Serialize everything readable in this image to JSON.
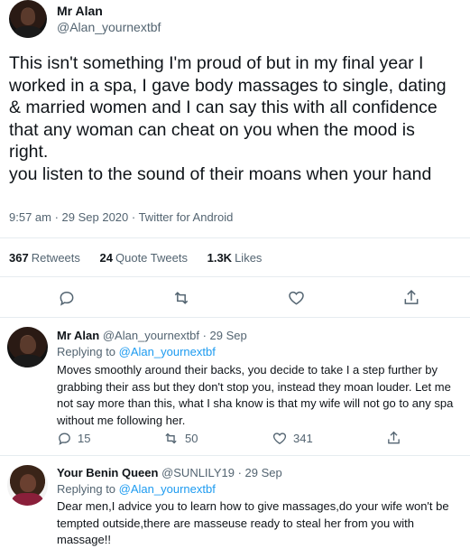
{
  "main_tweet": {
    "author_name": "Mr Alan",
    "author_handle": "@Alan_yournextbf",
    "text_lines": [
      "This isn't something I'm proud of but in my final year I",
      "worked in a spa, I gave body massages to single, dating",
      "& married women and I can say this with all confidence",
      "that any woman can cheat on you when the mood is",
      "right.",
      "you listen to the sound of their moans when your hand"
    ],
    "timestamp": "9:57 am · 29 Sep 2020 · Twitter for Android",
    "retweets_count": "367",
    "retweets_label": "Retweets",
    "quotes_count": "24",
    "quotes_label": "Quote Tweets",
    "likes_count": "1.3K",
    "likes_label": "Likes"
  },
  "replies": [
    {
      "author_name": "Mr Alan",
      "author_handle": "@Alan_yournextbf",
      "date": "· 29 Sep",
      "replying_to_label": "Replying to",
      "replying_to_handle": "@Alan_yournextbf",
      "text_lines": [
        "Moves smoothly around their backs, you decide to take I a step further by",
        "grabbing their ass but they don't stop you, instead they moan louder. Let me",
        "not say more than this, what I sha know is that my wife will not go to any spa",
        "without me following her."
      ],
      "reply_count": "15",
      "retweet_count": "50",
      "like_count": "341"
    },
    {
      "author_name": "Your Benin Queen",
      "author_handle": "@SUNLILY19",
      "date": "· 29 Sep",
      "replying_to_label": "Replying to",
      "replying_to_handle": "@Alan_yournextbf",
      "text_lines": [
        "Dear men,I advice you to learn how to give massages,do your wife won't be",
        "tempted outside,there are masseuse ready to steal her from you with",
        "massage!!"
      ]
    }
  ],
  "colors": {
    "accent": "#1d9bf0",
    "muted": "#536471",
    "text": "#0f1419",
    "divider": "#e6ecf0"
  }
}
